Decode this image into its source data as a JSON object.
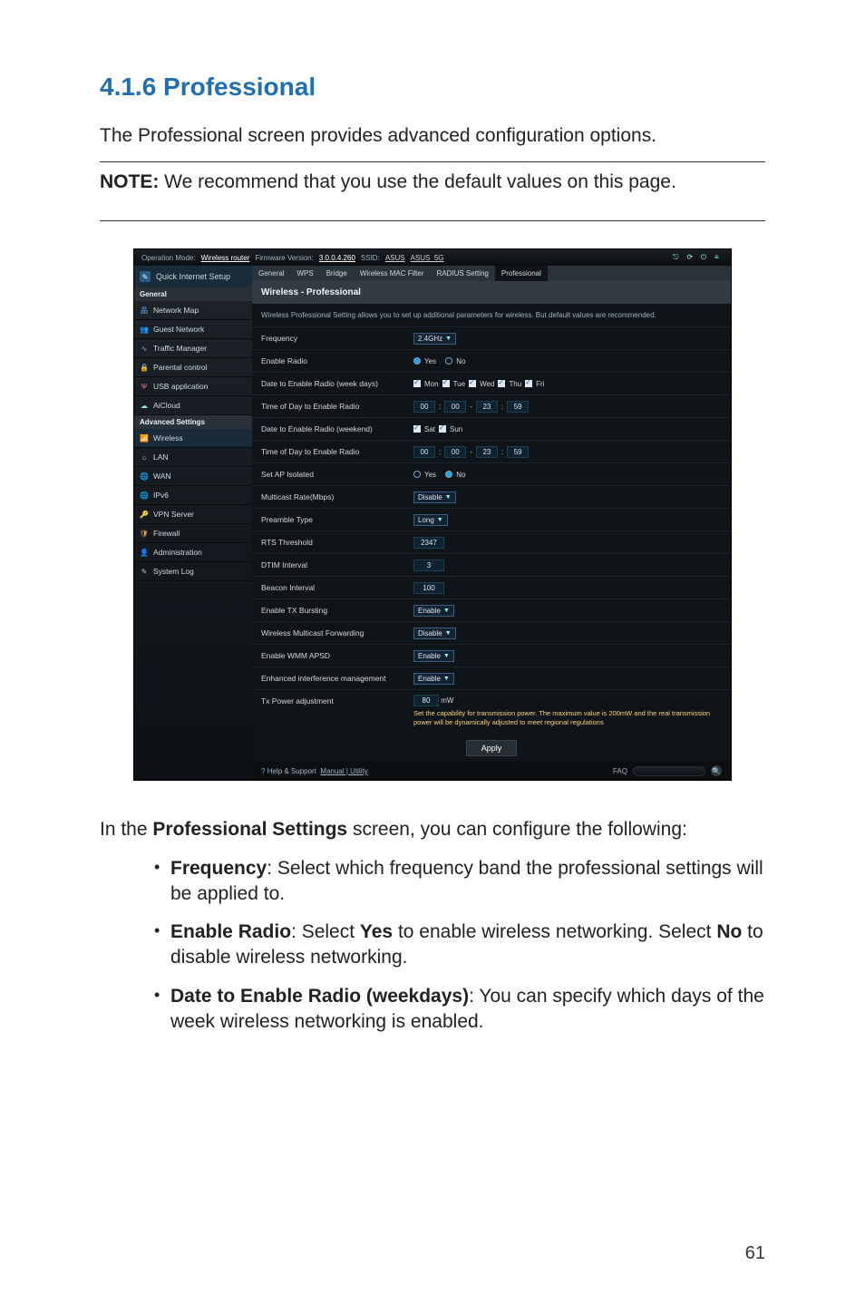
{
  "section_title": "4.1.6 Professional",
  "lead": "The Professional screen provides advanced configuration options.",
  "note_label": "NOTE:",
  "note_text": "  We recommend that you use the default values on this page.",
  "after_intro_1": "In the ",
  "after_intro_bold": "Professional Settings",
  "after_intro_2": " screen, you can configure the following:",
  "bullets": [
    {
      "bold": "Frequency",
      "text": ":  Select which frequency band the professional settings will be applied to."
    },
    {
      "bold": "Enable Radio",
      "text": ":  Select ",
      "bold2": "Yes",
      "text2": " to enable wireless networking. Select ",
      "bold3": "No",
      "text3": " to disable wireless networking."
    },
    {
      "bold": "Date to Enable Radio (weekdays)",
      "text": ":  You can specify which days of the week wireless networking is enabled."
    }
  ],
  "page_number": "61",
  "router": {
    "qis": "Quick Internet Setup",
    "topbar": {
      "op_label": "Operation Mode:",
      "op_value": "Wireless router",
      "fw_label": "Firmware Version:",
      "fw_value": "3.0.0.4.260",
      "ssid_label": "SSID:",
      "ssid1": "ASUS",
      "ssid2": "ASUS_5G"
    },
    "tabs": [
      "General",
      "WPS",
      "Bridge",
      "Wireless MAC Filter",
      "RADIUS Setting",
      "Professional"
    ],
    "panel_title": "Wireless - Professional",
    "panel_sub": "Wireless Professional Setting allows you to set up additional parameters for wireless. But default values are recommended.",
    "sidebar": {
      "general_hd": "General",
      "general": [
        {
          "icon": "nodes-icon",
          "color": "c-blue",
          "label": "Network Map"
        },
        {
          "icon": "people-icon",
          "color": "c-green",
          "label": "Guest Network"
        },
        {
          "icon": "pulse-icon",
          "color": "c-blue",
          "label": "Traffic Manager"
        },
        {
          "icon": "lock-icon",
          "color": "c-orange",
          "label": "Parental control"
        },
        {
          "icon": "usb-icon",
          "color": "c-red",
          "label": "USB application"
        },
        {
          "icon": "cloud-icon",
          "color": "c-teal",
          "label": "AiCloud"
        }
      ],
      "advanced_hd": "Advanced Settings",
      "advanced": [
        {
          "icon": "wifi-icon",
          "color": "c-blue",
          "label": "Wireless",
          "active": true
        },
        {
          "icon": "home-icon",
          "color": "c-orange",
          "label": "LAN"
        },
        {
          "icon": "globe-icon",
          "color": "c-blue",
          "label": "WAN"
        },
        {
          "icon": "globe-icon",
          "color": "c-teal",
          "label": "IPv6"
        },
        {
          "icon": "key-icon",
          "color": "c-orange",
          "label": "VPN Server"
        },
        {
          "icon": "shield-icon",
          "color": "c-orange",
          "label": "Firewall"
        },
        {
          "icon": "user-icon",
          "color": "c-gray",
          "label": "Administration"
        },
        {
          "icon": "log-icon",
          "color": "c-green",
          "label": "System Log"
        }
      ]
    },
    "rows": {
      "frequency": {
        "label": "Frequency",
        "value": "2.4GHz"
      },
      "enable_radio": {
        "label": "Enable Radio",
        "yes": "Yes",
        "no": "No"
      },
      "date_week": {
        "label": "Date to Enable Radio (week days)",
        "days": [
          "Mon",
          "Tue",
          "Wed",
          "Thu",
          "Fri"
        ]
      },
      "time_week": {
        "label": "Time of Day to Enable Radio",
        "h1": "00",
        "m1": "00",
        "h2": "23",
        "m2": "59"
      },
      "date_weekend": {
        "label": "Date to Enable Radio (weekend)",
        "days": [
          "Sat",
          "Sun"
        ]
      },
      "time_weekend": {
        "label": "Time of Day to Enable Radio",
        "h1": "00",
        "m1": "00",
        "h2": "23",
        "m2": "59"
      },
      "ap_isolated": {
        "label": "Set AP Isolated",
        "yes": "Yes",
        "no": "No"
      },
      "mcast": {
        "label": "Multicast Rate(Mbps)",
        "value": "Disable"
      },
      "preamble": {
        "label": "Preamble Type",
        "value": "Long"
      },
      "rts": {
        "label": "RTS Threshold",
        "value": "2347"
      },
      "dtim": {
        "label": "DTIM Interval",
        "value": "3"
      },
      "beacon": {
        "label": "Beacon Interval",
        "value": "100"
      },
      "txburst": {
        "label": "Enable TX Bursting",
        "value": "Enable"
      },
      "wmf": {
        "label": "Wireless Multicast Forwarding",
        "value": "Disable"
      },
      "wmm": {
        "label": "Enable WMM APSD",
        "value": "Enable"
      },
      "eim": {
        "label": "Enhanced interference management",
        "value": "Enable"
      },
      "txpower": {
        "label": "Tx Power adjustment",
        "value": "80",
        "unit": "mW",
        "hint": "Set the capability for transmission power. The maximum value is 200mW and the real transmission power will be dynamically adjusted to meet regional regulations"
      }
    },
    "apply": "Apply",
    "footer": {
      "help": "Help & Support",
      "links": "Manual | Utility",
      "faq": "FAQ"
    }
  }
}
